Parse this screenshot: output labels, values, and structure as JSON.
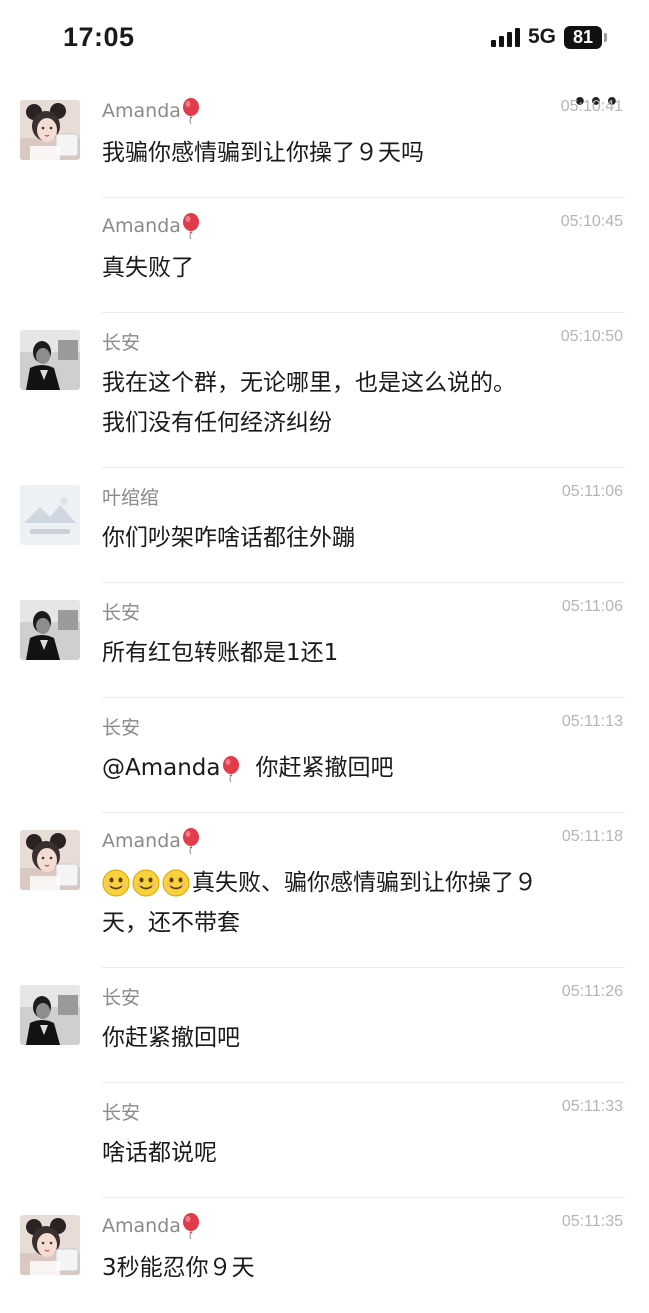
{
  "status_bar": {
    "time": "17:05",
    "network": "5G",
    "battery": "81"
  },
  "colors": {
    "sender": "#8a8a8a",
    "timestamp": "#b5b5b5",
    "text": "#1a1a1a",
    "balloon": "#e23b4a"
  },
  "messages": [
    {
      "sender": "Amanda",
      "balloon": true,
      "time": "05:10:41",
      "avatar": "amanda-avatar",
      "text": [
        "我骗你感情骗到让你操了９天吗"
      ]
    },
    {
      "sender": "Amanda",
      "balloon": true,
      "time": "05:10:45",
      "avatar": "",
      "text": [
        "真失败了"
      ]
    },
    {
      "sender": "长安",
      "balloon": false,
      "time": "05:10:50",
      "avatar": "changan-avatar",
      "text": [
        "我在这个群，无论哪里，也是这么说的。",
        "我们没有任何经济纠纷"
      ]
    },
    {
      "sender": "叶绾绾",
      "balloon": false,
      "time": "05:11:06",
      "avatar": "yewanwan-avatar",
      "text": [
        "你们吵架咋啥话都往外蹦"
      ]
    },
    {
      "sender": "长安",
      "balloon": false,
      "time": "05:11:06",
      "avatar": "changan-avatar",
      "text": [
        "所有红包转账都是1还1"
      ]
    },
    {
      "sender": "长安",
      "balloon": false,
      "time": "05:11:13",
      "avatar": "",
      "mention": "@Amanda",
      "text": [
        "你赶紧撤回吧"
      ]
    },
    {
      "sender": "Amanda",
      "balloon": true,
      "time": "05:11:18",
      "avatar": "amanda-avatar",
      "emojis": 3,
      "text": [
        "真失败、骗你感情骗到让你操了９",
        "天，还不带套"
      ]
    },
    {
      "sender": "长安",
      "balloon": false,
      "time": "05:11:26",
      "avatar": "changan-avatar",
      "text": [
        "你赶紧撤回吧"
      ]
    },
    {
      "sender": "长安",
      "balloon": false,
      "time": "05:11:33",
      "avatar": "",
      "text": [
        "啥话都说呢"
      ]
    },
    {
      "sender": "Amanda",
      "balloon": true,
      "time": "05:11:35",
      "avatar": "amanda-avatar",
      "text": [
        "3秒能忍你９天"
      ]
    }
  ]
}
